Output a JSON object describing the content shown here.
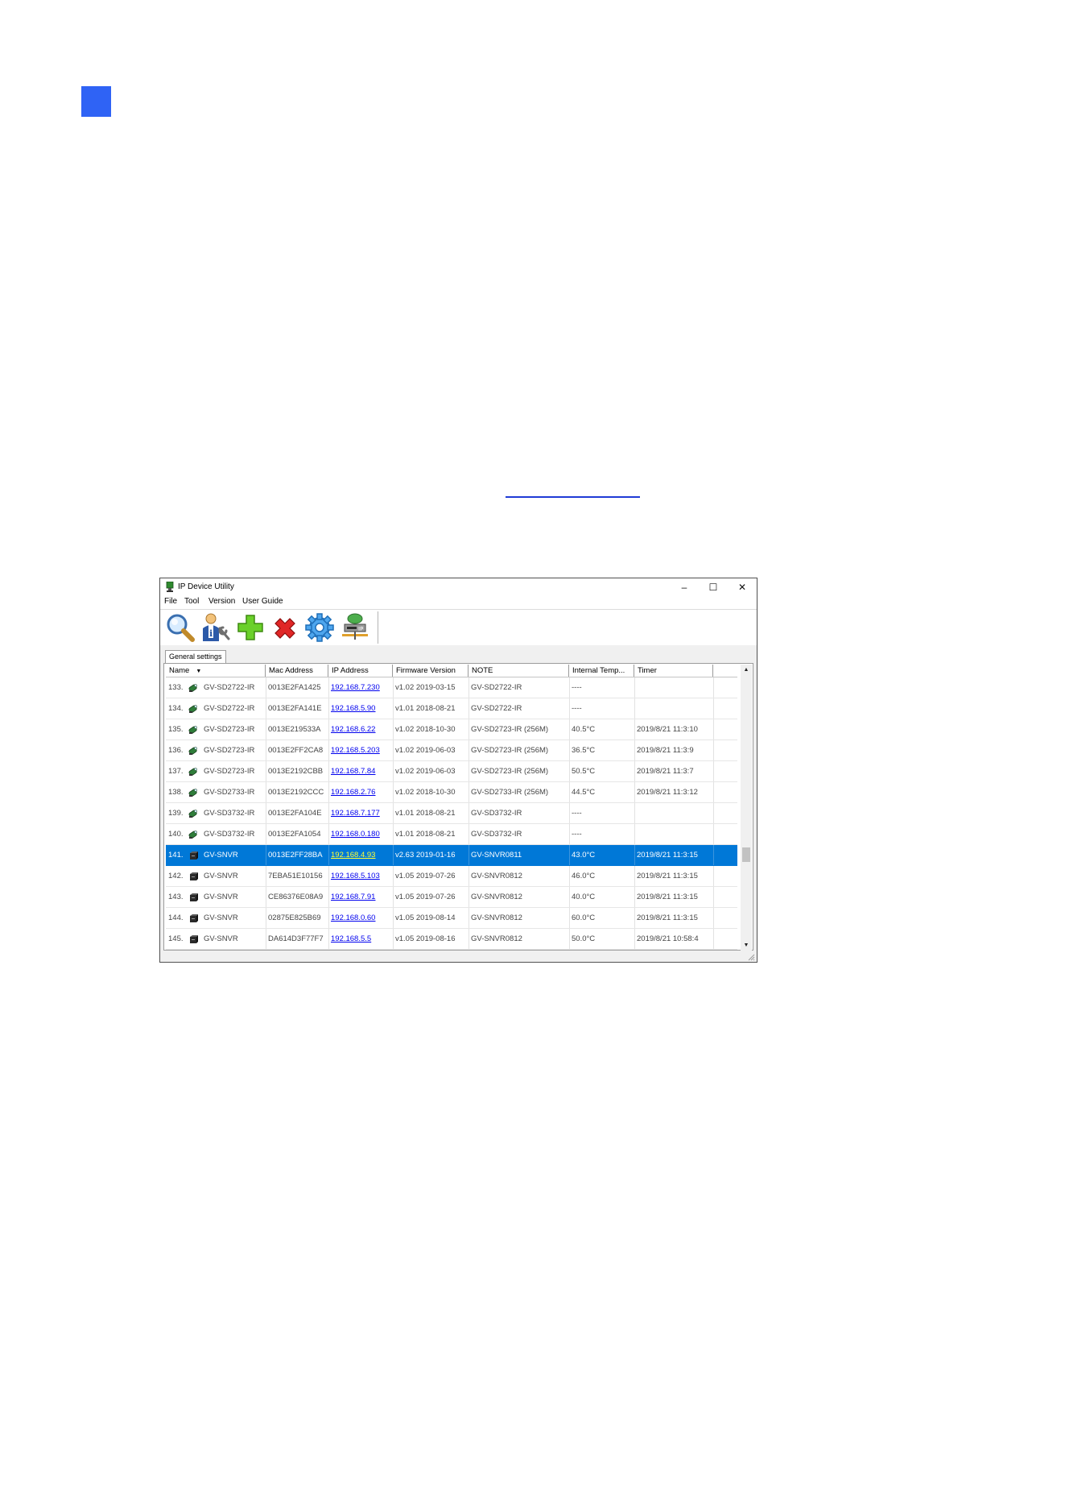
{
  "window": {
    "title": "IP Device Utility",
    "controls": {
      "minimize": "–",
      "maximize": "☐",
      "close": "✕"
    }
  },
  "menu": [
    "File",
    "Tool",
    "Version",
    "User Guide"
  ],
  "toolbar": [
    {
      "icon": "search-icon"
    },
    {
      "icon": "user-settings-icon"
    },
    {
      "icon": "add-icon"
    },
    {
      "icon": "delete-icon"
    },
    {
      "icon": "gear-icon"
    },
    {
      "icon": "network-device-icon"
    }
  ],
  "tabs": {
    "general": "General settings"
  },
  "table": {
    "columns": [
      "Name",
      "Mac Address",
      "IP Address",
      "Firmware Version",
      "NOTE",
      "Internal Temp...",
      "Timer"
    ],
    "sort_arrow": "▼",
    "selected_index": 8,
    "rows": [
      {
        "num": "133.",
        "icon": "camera-icon",
        "name": "GV-SD2722-IR",
        "mac": "0013E2FA1425",
        "ip": "192.168.7.230",
        "firmware": "v1.02  2019-03-15",
        "note": "GV-SD2722-IR",
        "temp": "----",
        "timer": ""
      },
      {
        "num": "134.",
        "icon": "camera-icon",
        "name": "GV-SD2722-IR",
        "mac": "0013E2FA141E",
        "ip": "192.168.5.90",
        "firmware": "v1.01  2018-08-21",
        "note": "GV-SD2722-IR",
        "temp": "----",
        "timer": ""
      },
      {
        "num": "135.",
        "icon": "camera-icon",
        "name": "GV-SD2723-IR",
        "mac": "0013E219533A",
        "ip": "192.168.6.22",
        "firmware": "v1.02  2018-10-30",
        "note": "GV-SD2723-IR (256M)",
        "temp": "40.5°C",
        "timer": "2019/8/21 11:3:10"
      },
      {
        "num": "136.",
        "icon": "camera-icon",
        "name": "GV-SD2723-IR",
        "mac": "0013E2FF2CA8",
        "ip": "192.168.5.203",
        "firmware": "v1.02  2019-06-03",
        "note": "GV-SD2723-IR (256M)",
        "temp": "36.5°C",
        "timer": "2019/8/21 11:3:9"
      },
      {
        "num": "137.",
        "icon": "camera-icon",
        "name": "GV-SD2723-IR",
        "mac": "0013E2192CBB",
        "ip": "192.168.7.84",
        "firmware": "v1.02  2019-06-03",
        "note": "GV-SD2723-IR (256M)",
        "temp": "50.5°C",
        "timer": "2019/8/21 11:3:7"
      },
      {
        "num": "138.",
        "icon": "camera-icon",
        "name": "GV-SD2733-IR",
        "mac": "0013E2192CCC",
        "ip": "192.168.2.76",
        "firmware": "v1.02  2018-10-30",
        "note": "GV-SD2733-IR (256M)",
        "temp": "44.5°C",
        "timer": "2019/8/21 11:3:12"
      },
      {
        "num": "139.",
        "icon": "camera-icon",
        "name": "GV-SD3732-IR",
        "mac": "0013E2FA104E",
        "ip": "192.168.7.177",
        "firmware": "v1.01  2018-08-21",
        "note": "GV-SD3732-IR",
        "temp": "----",
        "timer": ""
      },
      {
        "num": "140.",
        "icon": "camera-icon",
        "name": "GV-SD3732-IR",
        "mac": "0013E2FA1054",
        "ip": "192.168.0.180",
        "firmware": "v1.01  2018-08-21",
        "note": "GV-SD3732-IR",
        "temp": "----",
        "timer": ""
      },
      {
        "num": "141.",
        "icon": "nvr-icon",
        "name": "GV-SNVR",
        "mac": "0013E2FF28BA",
        "ip": "192.168.4.93",
        "firmware": "v2.63  2019-01-16",
        "note": "GV-SNVR0811",
        "temp": "43.0°C",
        "timer": "2019/8/21 11:3:15"
      },
      {
        "num": "142.",
        "icon": "nvr-icon",
        "name": "GV-SNVR",
        "mac": "7EBA51E10156",
        "ip": "192.168.5.103",
        "firmware": "v1.05  2019-07-26",
        "note": "GV-SNVR0812",
        "temp": "46.0°C",
        "timer": "2019/8/21 11:3:15"
      },
      {
        "num": "143.",
        "icon": "nvr-icon",
        "name": "GV-SNVR",
        "mac": "CE86376E08A9",
        "ip": "192.168.7.91",
        "firmware": "v1.05  2019-07-26",
        "note": "GV-SNVR0812",
        "temp": "40.0°C",
        "timer": "2019/8/21 11:3:15"
      },
      {
        "num": "144.",
        "icon": "nvr-icon",
        "name": "GV-SNVR",
        "mac": "02875E825B69",
        "ip": "192.168.0.60",
        "firmware": "v1.05  2019-08-14",
        "note": "GV-SNVR0812",
        "temp": "60.0°C",
        "timer": "2019/8/21 11:3:15"
      },
      {
        "num": "145.",
        "icon": "nvr-icon",
        "name": "GV-SNVR",
        "mac": "DA614D3F77F7",
        "ip": "192.168.5.5",
        "firmware": "v1.05  2019-08-16",
        "note": "GV-SNVR0812",
        "temp": "50.0°C",
        "timer": "2019/8/21 10:58:4"
      }
    ]
  },
  "scrollbar": {
    "up": "▲",
    "down": "▼"
  },
  "colors": {
    "selection": "#0078d7",
    "link": "#0000ee",
    "selected_link": "#ffff33",
    "chapter_marker": "#2f63f5"
  }
}
